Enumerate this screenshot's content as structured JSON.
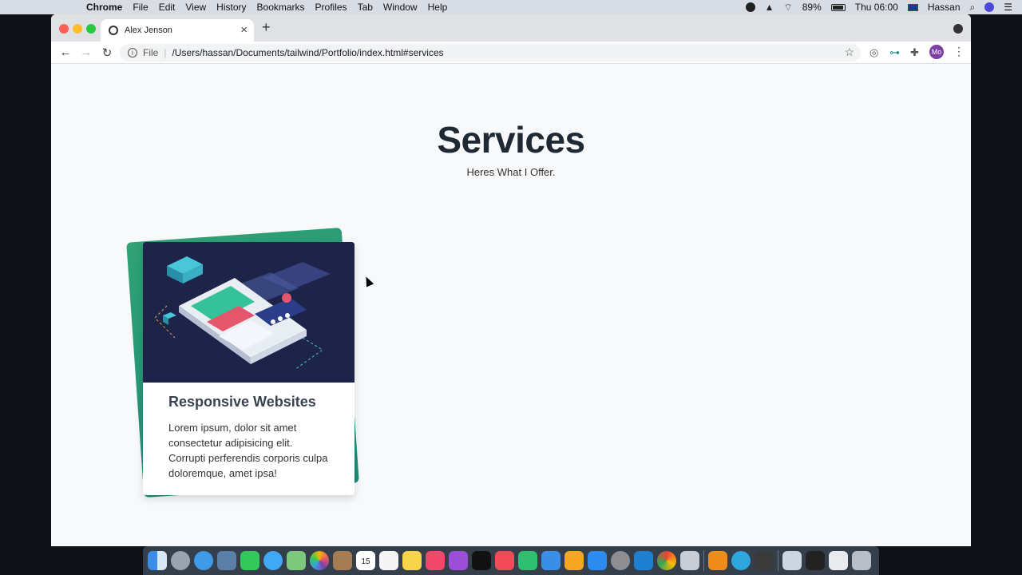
{
  "menubar": {
    "app_name": "Chrome",
    "items": [
      "File",
      "Edit",
      "View",
      "History",
      "Bookmarks",
      "Profiles",
      "Tab",
      "Window",
      "Help"
    ],
    "battery": "89%",
    "clock": "Thu 06:00",
    "user": "Hassan"
  },
  "browser": {
    "tab_title": "Alex Jenson",
    "url_scheme": "File",
    "url": "/Users/hassan/Documents/tailwind/Portfolio/index.html#services",
    "profile_initials": "Mo"
  },
  "page": {
    "title": "Services",
    "subtitle": "Heres What I Offer.",
    "card": {
      "title": "Responsive Websites",
      "body": "Lorem ipsum, dolor sit amet consectetur adipisicing elit. Corrupti perferendis corporis culpa doloremque, amet ipsa!",
      "back_gradient": [
        "#30a275",
        "#1b8c7a"
      ]
    }
  },
  "dock": {
    "icons": [
      "finder-icon",
      "launchpad-icon",
      "safari-icon",
      "preview-icon",
      "facetime-icon",
      "messages-icon",
      "maps-icon",
      "photos-icon",
      "contacts-icon",
      "calendar-icon",
      "reminders-icon",
      "notes-icon",
      "music-icon",
      "podcasts-icon",
      "tv-icon",
      "news-icon",
      "numbers-icon",
      "keynote-icon",
      "pages-icon",
      "app-store-icon",
      "system-preferences-icon",
      "vscode-icon",
      "chrome-icon",
      "disk-utility-icon",
      "vlc-icon",
      "telegram-icon",
      "davinci-icon",
      "clipboard-icon",
      "terminal-icon",
      "file-icon",
      "trash-icon"
    ],
    "calendar_day": "15"
  }
}
